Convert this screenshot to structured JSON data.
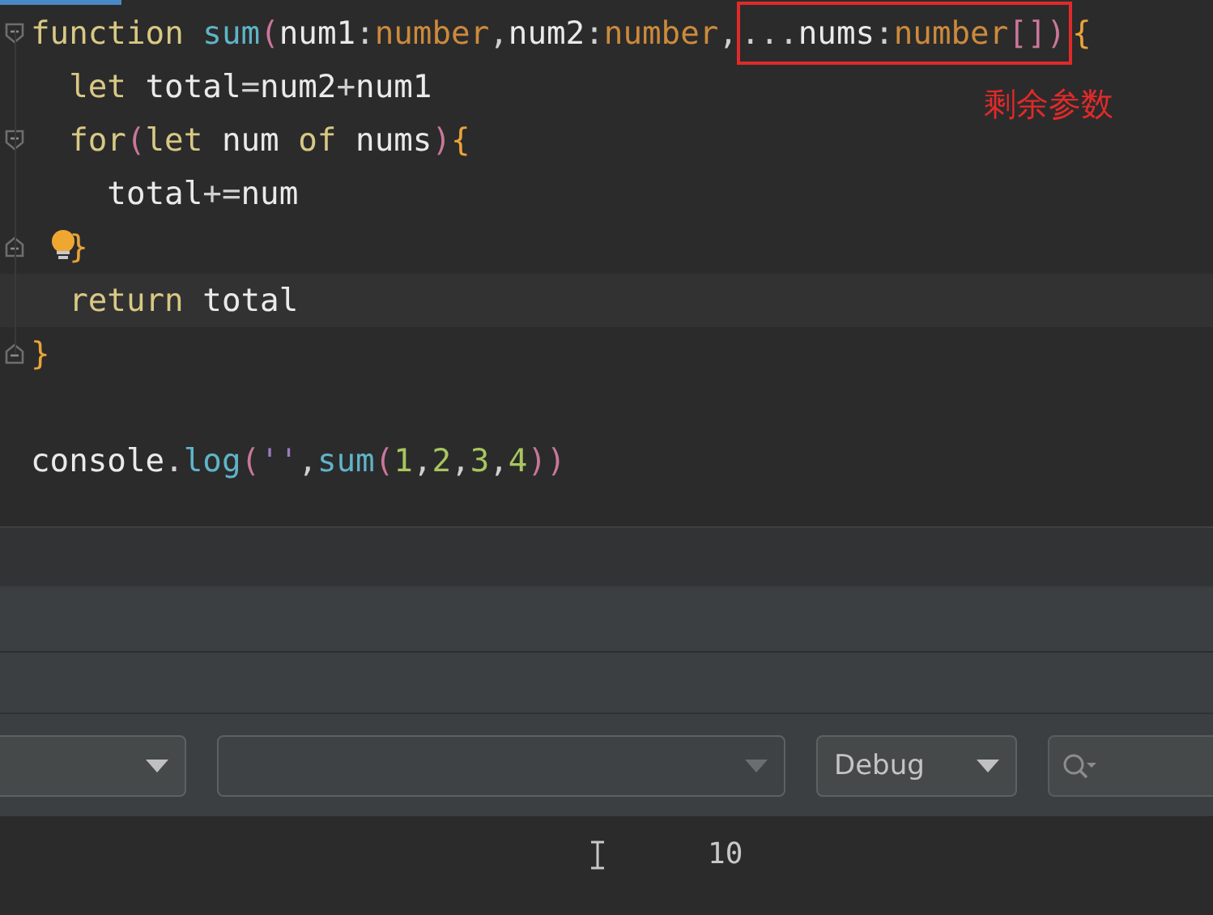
{
  "editor": {
    "lines": [
      {
        "fold_start": true,
        "tokens": [
          {
            "text": "function ",
            "kind": "kw"
          },
          {
            "text": "sum",
            "kind": "fn"
          },
          {
            "text": "(",
            "kind": "paren"
          },
          {
            "text": "num1",
            "kind": "ident"
          },
          {
            "text": ":",
            "kind": "punct"
          },
          {
            "text": "number",
            "kind": "type"
          },
          {
            "text": ",",
            "kind": "punct"
          },
          {
            "text": "num2",
            "kind": "ident"
          },
          {
            "text": ":",
            "kind": "punct"
          },
          {
            "text": "number",
            "kind": "type"
          },
          {
            "text": ",",
            "kind": "punct"
          },
          {
            "text": "...",
            "kind": "punct",
            "boxed": true
          },
          {
            "text": "nums",
            "kind": "ident",
            "boxed": true
          },
          {
            "text": ":",
            "kind": "punct",
            "boxed": true
          },
          {
            "text": "number",
            "kind": "type",
            "boxed": true
          },
          {
            "text": "[]",
            "kind": "paren",
            "boxed": true
          },
          {
            "text": ")",
            "kind": "paren",
            "boxed": true
          },
          {
            "text": "{",
            "kind": "brace"
          }
        ],
        "children": [
          {
            "tokens": [
              {
                "text": "let ",
                "kind": "kw"
              },
              {
                "text": "total",
                "kind": "ident"
              },
              {
                "text": "=",
                "kind": "punct"
              },
              {
                "text": "num2",
                "kind": "ident"
              },
              {
                "text": "+",
                "kind": "punct"
              },
              {
                "text": "num1",
                "kind": "ident"
              }
            ]
          },
          {
            "fold_start": true,
            "tokens": [
              {
                "text": "for",
                "kind": "kw"
              },
              {
                "text": "(",
                "kind": "paren"
              },
              {
                "text": "let ",
                "kind": "kw"
              },
              {
                "text": "num ",
                "kind": "ident"
              },
              {
                "text": "of ",
                "kind": "kw"
              },
              {
                "text": "nums",
                "kind": "ident"
              },
              {
                "text": ")",
                "kind": "paren"
              },
              {
                "text": "{",
                "kind": "brace"
              }
            ],
            "children": [
              {
                "tokens": [
                  {
                    "text": "total",
                    "kind": "ident"
                  },
                  {
                    "text": "+=",
                    "kind": "punct"
                  },
                  {
                    "text": "num",
                    "kind": "ident"
                  }
                ]
              }
            ]
          },
          {
            "fold_end": true,
            "bulb": true,
            "tokens": [
              {
                "text": "}",
                "kind": "brace"
              }
            ]
          },
          {
            "current": true,
            "tokens": [
              {
                "text": "return ",
                "kind": "kw"
              },
              {
                "text": "total",
                "kind": "ident"
              }
            ]
          }
        ]
      },
      {
        "fold_end": true,
        "tokens": [
          {
            "text": "}",
            "kind": "brace"
          }
        ]
      },
      {
        "blank_before": true,
        "tokens": [
          {
            "text": "console",
            "kind": "ident"
          },
          {
            "text": ".",
            "kind": "punct"
          },
          {
            "text": "log",
            "kind": "fn"
          },
          {
            "text": "(",
            "kind": "paren"
          },
          {
            "text": "''",
            "kind": "str"
          },
          {
            "text": ",",
            "kind": "punct"
          },
          {
            "text": "sum",
            "kind": "fn"
          },
          {
            "text": "(",
            "kind": "paren"
          },
          {
            "text": "1",
            "kind": "num"
          },
          {
            "text": ",",
            "kind": "punct"
          },
          {
            "text": "2",
            "kind": "num"
          },
          {
            "text": ",",
            "kind": "punct"
          },
          {
            "text": "3",
            "kind": "num"
          },
          {
            "text": ",",
            "kind": "punct"
          },
          {
            "text": "4",
            "kind": "num"
          },
          {
            "text": "))",
            "kind": "paren"
          }
        ]
      }
    ],
    "annotation": "剩余参数"
  },
  "toolbar": {
    "controls": [
      {
        "kind": "select",
        "disabled": false
      },
      {
        "kind": "select",
        "disabled": true
      },
      {
        "kind": "select",
        "disabled": false,
        "value": "Debug"
      },
      {
        "kind": "search"
      }
    ]
  },
  "console": {
    "output": "10"
  }
}
